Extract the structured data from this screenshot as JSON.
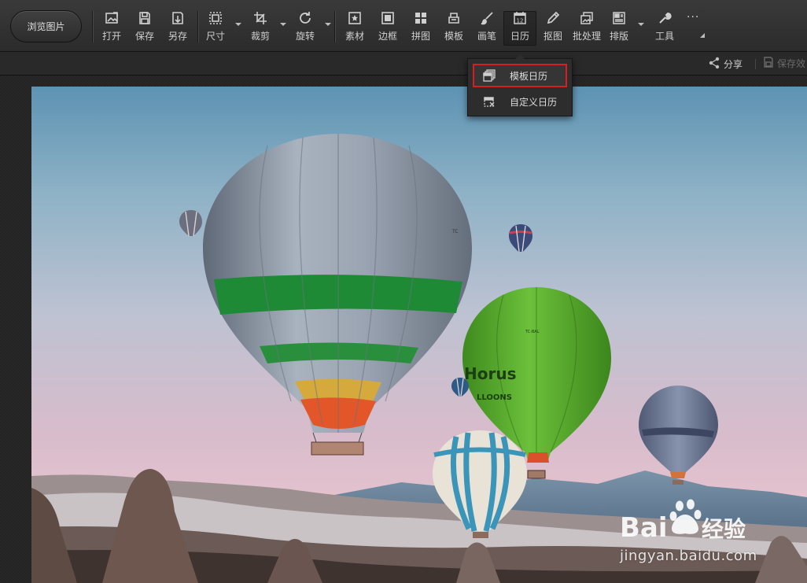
{
  "toolbar": {
    "browse_label": "浏览图片",
    "tools": [
      {
        "label": "打开",
        "icon": "open-image-icon"
      },
      {
        "label": "保存",
        "icon": "save-icon"
      },
      {
        "label": "另存",
        "icon": "save-as-icon"
      },
      {
        "label": "尺寸",
        "icon": "resize-icon"
      },
      {
        "label": "裁剪",
        "icon": "crop-icon"
      },
      {
        "label": "旋转",
        "icon": "rotate-icon"
      },
      {
        "label": "素材",
        "icon": "sticker-icon"
      },
      {
        "label": "边框",
        "icon": "frame-icon"
      },
      {
        "label": "拼图",
        "icon": "collage-icon"
      },
      {
        "label": "模板",
        "icon": "template-icon"
      },
      {
        "label": "画笔",
        "icon": "brush-icon"
      },
      {
        "label": "日历",
        "icon": "calendar-icon"
      },
      {
        "label": "抠图",
        "icon": "cutout-icon"
      },
      {
        "label": "批处理",
        "icon": "batch-icon"
      },
      {
        "label": "排版",
        "icon": "layout-icon"
      },
      {
        "label": "工具",
        "icon": "wrench-icon"
      }
    ],
    "more_label": "···",
    "calendar_icon_number": "12"
  },
  "subbar": {
    "share_label": "分享",
    "save_effect_label": "保存效"
  },
  "calendar_menu": {
    "items": [
      {
        "label": "模板日历",
        "icon": "template-calendar-icon",
        "highlighted": true
      },
      {
        "label": "自定义日历",
        "icon": "custom-calendar-icon",
        "highlighted": false
      }
    ],
    "highlight_color": "#d81e1e"
  },
  "photo": {
    "balloon_texts": [
      "TC",
      "Horus",
      "LLOONS",
      "TC-BAL"
    ]
  },
  "watermark": {
    "logo": "Bai经验",
    "url": "jingyan.baidu.com"
  }
}
